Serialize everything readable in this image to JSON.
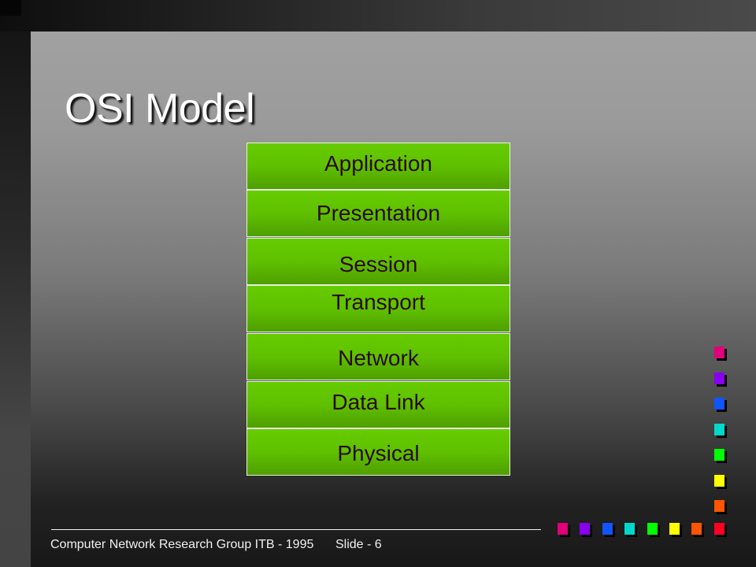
{
  "slide": {
    "title": "OSI Model",
    "layers": [
      {
        "label": "Application"
      },
      {
        "label": "Presentation"
      },
      {
        "label": "Session"
      },
      {
        "label": "Transport"
      },
      {
        "label": "Network"
      },
      {
        "label": "Data Link"
      },
      {
        "label": "Physical"
      }
    ],
    "footer": {
      "organization": "Computer Network Research Group ITB - 1995",
      "slide_number": "Slide - 6"
    },
    "decor_colors": [
      "#e0007a",
      "#8800ee",
      "#1155ff",
      "#00d8cc",
      "#00ff00",
      "#ffff00",
      "#ff5500",
      "#ff0022"
    ]
  }
}
